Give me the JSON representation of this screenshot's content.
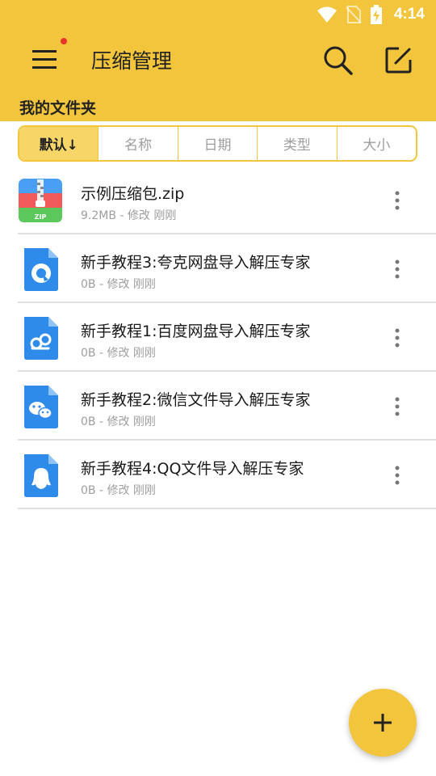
{
  "status_bar": {
    "time": "4:14",
    "icons": [
      "wifi-icon",
      "no-sim-icon",
      "battery-charging-icon"
    ]
  },
  "app_bar": {
    "title": "压缩管理",
    "menu_icon": "hamburger-menu-icon",
    "search_icon": "search-icon",
    "edit_icon": "edit-icon",
    "has_notification_dot": true
  },
  "folder": {
    "title": "我的文件夹"
  },
  "sort_tabs": [
    {
      "label": "默认↓",
      "active": true
    },
    {
      "label": "名称",
      "active": false
    },
    {
      "label": "日期",
      "active": false
    },
    {
      "label": "类型",
      "active": false
    },
    {
      "label": "大小",
      "active": false
    }
  ],
  "files": [
    {
      "name": "示例压缩包.zip",
      "meta": "9.2MB - 修改 刚刚",
      "icon": "zip-archive-icon"
    },
    {
      "name": "新手教程3:夸克网盘导入解压专家",
      "meta": "0B - 修改 刚刚",
      "icon": "quark-file-icon"
    },
    {
      "name": "新手教程1:百度网盘导入解压专家",
      "meta": "0B - 修改 刚刚",
      "icon": "baidu-netdisk-file-icon"
    },
    {
      "name": "新手教程2:微信文件导入解压专家",
      "meta": "0B - 修改 刚刚",
      "icon": "wechat-file-icon"
    },
    {
      "name": "新手教程4:QQ文件导入解压专家",
      "meta": "0B - 修改 刚刚",
      "icon": "qq-file-icon"
    }
  ],
  "fab": {
    "icon": "plus-icon"
  },
  "colors": {
    "accent": "#F2C53D",
    "accent_active": "#F7D566",
    "file_icon_blue": "#2E8BEA",
    "notification_dot": "#E8352B"
  }
}
